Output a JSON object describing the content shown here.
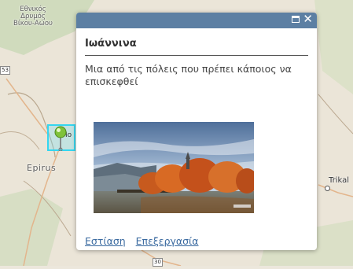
{
  "map": {
    "park_label": "Εθνικός Δρυμός Βίκου-Αώου",
    "region_label": "Epirus",
    "city2_label": "Trikal",
    "marker_label": "Io",
    "shield_a": "53",
    "shield_b": "30"
  },
  "popup": {
    "title": "Ιωάννινα",
    "description": "Μια από τις πόλεις που πρέπει κάποιος να επισκεφθεί",
    "actions": {
      "zoom": "Εστίαση",
      "edit": "Επεξεργασία"
    }
  },
  "colors": {
    "title_bar": "#5c7fa3",
    "highlight": "#34d6f0",
    "link": "#3a6aa0"
  }
}
